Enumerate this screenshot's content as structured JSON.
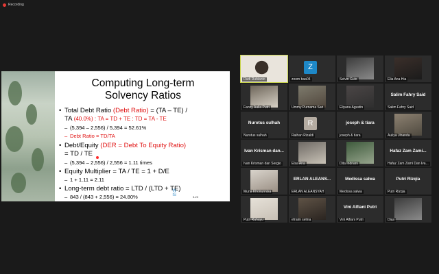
{
  "recording": {
    "label": "Recording"
  },
  "slide": {
    "title_line1": "Computing Long-term",
    "title_line2": "Solvency Ratios",
    "b1_line1a": "Total Debt Ratio ",
    "b1_line1b": "(Debt Ratio)",
    "b1_line1c": " = (TA – TE) /",
    "b1_line2a": "TA ",
    "b1_line2b": "(40.0%) : TA = TD + TE : TD = TA - TE",
    "b1_sub1": "(5,394 – 2,556) / 5,394 = 52.61%",
    "b1_sub2": "Debt Ratio = TD/TA",
    "b2_line1a": "Debt/Equity ",
    "b2_line1b": "(DER = Debt To Equity Ratio)",
    "b2_line2": "= TD / TE",
    "b2_sub1": "(5,394 – 2,556) / 2,556 = 1.11 times",
    "b3_line1": "Equity Multiplier = TA / TE = 1 + D/E",
    "b3_sub1": "1 + 1.11 = 2.11",
    "b4_line1": "Long-term debt ratio = LTD / (LTD + TE)",
    "b4_sub1": "843 / (843 + 2,556) = 24.80%",
    "logo_text1": "W",
    "logo_text2": "IS",
    "page_no": "3-23"
  },
  "participants": [
    {
      "name": "Dudi Rubianto",
      "type": "video",
      "active": true
    },
    {
      "name": "zoom baa04",
      "type": "avatar",
      "letter": "Z",
      "color": "#1e88c7"
    },
    {
      "name": "Selvin Gulo",
      "type": "video"
    },
    {
      "name": "Elia Ana Hia",
      "type": "video"
    },
    {
      "name": "Fanny Aulia Putri",
      "type": "video"
    },
    {
      "name": "Ummy Purnama Sari",
      "type": "video"
    },
    {
      "name": "Eliyana Agustin",
      "type": "video"
    },
    {
      "name": "Salim Fahry Said",
      "type": "text",
      "big": "Salim Fahry Said"
    },
    {
      "name": "Nurotus sulhah",
      "type": "text",
      "big": "Nurotus sulhah"
    },
    {
      "name": "Raihan Rizaldi",
      "type": "avatar",
      "letter": "R",
      "color": "#b5aca2"
    },
    {
      "name": "joseph & tiara",
      "type": "text",
      "big": "joseph & tiara"
    },
    {
      "name": "Auliya Jihanda",
      "type": "video"
    },
    {
      "name": "Ivan Krisman dan Sergio",
      "type": "text",
      "big": "Ivan Krisman dan..."
    },
    {
      "name": "Elsa Ana",
      "type": "video"
    },
    {
      "name": "Dita Indriani",
      "type": "video"
    },
    {
      "name": "Hafaz Zam Zami Dan Iva...",
      "type": "text",
      "big": "Hafaz Zam Zami..."
    },
    {
      "name": "Muna Khoirunnisa",
      "type": "video"
    },
    {
      "name": "ERLAN ALEANSYAH",
      "type": "text",
      "big": "ERLAN ALEANS..."
    },
    {
      "name": "Medissa salwa",
      "type": "text",
      "big": "Medissa salwa"
    },
    {
      "name": "Putri Rizqia",
      "type": "text",
      "big": "Putri Rizqia"
    },
    {
      "name": "Putri Rahayu",
      "type": "video"
    },
    {
      "name": "efraim selina",
      "type": "video"
    },
    {
      "name": "Vini Alfiani Putri",
      "type": "text",
      "big": "Vini Alfiani Putri"
    },
    {
      "name": "Dias",
      "type": "video"
    }
  ]
}
